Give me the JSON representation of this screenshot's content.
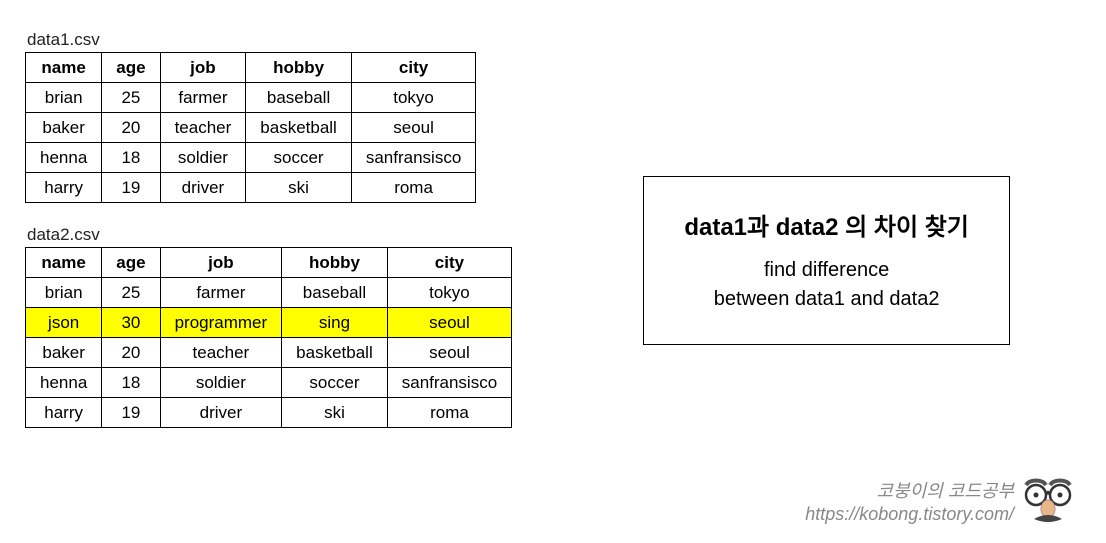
{
  "tables": [
    {
      "label": "data1.csv",
      "headers": [
        "name",
        "age",
        "job",
        "hobby",
        "city"
      ],
      "rows": [
        {
          "cells": [
            "brian",
            "25",
            "farmer",
            "baseball",
            "tokyo"
          ],
          "highlight": false
        },
        {
          "cells": [
            "baker",
            "20",
            "teacher",
            "basketball",
            "seoul"
          ],
          "highlight": false
        },
        {
          "cells": [
            "henna",
            "18",
            "soldier",
            "soccer",
            "sanfransisco"
          ],
          "highlight": false
        },
        {
          "cells": [
            "harry",
            "19",
            "driver",
            "ski",
            "roma"
          ],
          "highlight": false
        }
      ]
    },
    {
      "label": "data2.csv",
      "headers": [
        "name",
        "age",
        "job",
        "hobby",
        "city"
      ],
      "rows": [
        {
          "cells": [
            "brian",
            "25",
            "farmer",
            "baseball",
            "tokyo"
          ],
          "highlight": false
        },
        {
          "cells": [
            "json",
            "30",
            "programmer",
            "sing",
            "seoul"
          ],
          "highlight": true
        },
        {
          "cells": [
            "baker",
            "20",
            "teacher",
            "basketball",
            "seoul"
          ],
          "highlight": false
        },
        {
          "cells": [
            "henna",
            "18",
            "soldier",
            "soccer",
            "sanfransisco"
          ],
          "highlight": false
        },
        {
          "cells": [
            "harry",
            "19",
            "driver",
            "ski",
            "roma"
          ],
          "highlight": false
        }
      ]
    }
  ],
  "info": {
    "title": "data1과 data2 의 차이 찾기",
    "line1": "find difference",
    "line2": "between data1 and data2"
  },
  "watermark": {
    "line1": "코붕이의 코드공부",
    "line2": "https://kobong.tistory.com/"
  }
}
